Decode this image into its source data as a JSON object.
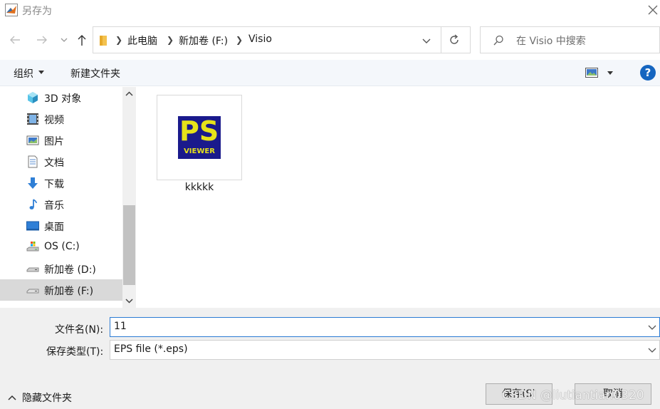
{
  "window": {
    "title": "另存为"
  },
  "nav": {
    "breadcrumbs": [
      "此电脑",
      "新加卷 (F:)",
      "Visio"
    ],
    "search_placeholder": "在 Visio 中搜索"
  },
  "toolbar": {
    "organize_label": "组织",
    "new_folder_label": "新建文件夹"
  },
  "sidebar": {
    "items": [
      {
        "label": "3D 对象",
        "icon": "3d-objects-icon"
      },
      {
        "label": "视频",
        "icon": "video-icon"
      },
      {
        "label": "图片",
        "icon": "pictures-icon"
      },
      {
        "label": "文档",
        "icon": "documents-icon"
      },
      {
        "label": "下载",
        "icon": "download-icon"
      },
      {
        "label": "音乐",
        "icon": "music-icon"
      },
      {
        "label": "桌面",
        "icon": "desktop-icon"
      },
      {
        "label": "OS (C:)",
        "icon": "drive-icon"
      },
      {
        "label": "新加卷 (D:)",
        "icon": "drive-icon"
      },
      {
        "label": "新加卷 (F:)",
        "icon": "drive-icon",
        "selected": true
      }
    ]
  },
  "files": [
    {
      "name": "kkkkk",
      "icon": "ps-viewer-icon",
      "icon_text_top": "PS",
      "icon_text_bottom": "VIEWER"
    }
  ],
  "form": {
    "filename_label": "文件名(N):",
    "filename_value": "11",
    "filetype_label": "保存类型(T):",
    "filetype_value": "EPS file (*.eps)",
    "hide_folders_label": "隐藏文件夹",
    "save_label": "保存(S)",
    "cancel_label": "取消"
  },
  "watermark": "CSDN @liutiantian0320",
  "colors": {
    "accent": "#1565c0",
    "toolbar_bg": "#f4f7fb",
    "form_bg": "#f0f0f0",
    "selected_bg": "#d9d9d9"
  }
}
